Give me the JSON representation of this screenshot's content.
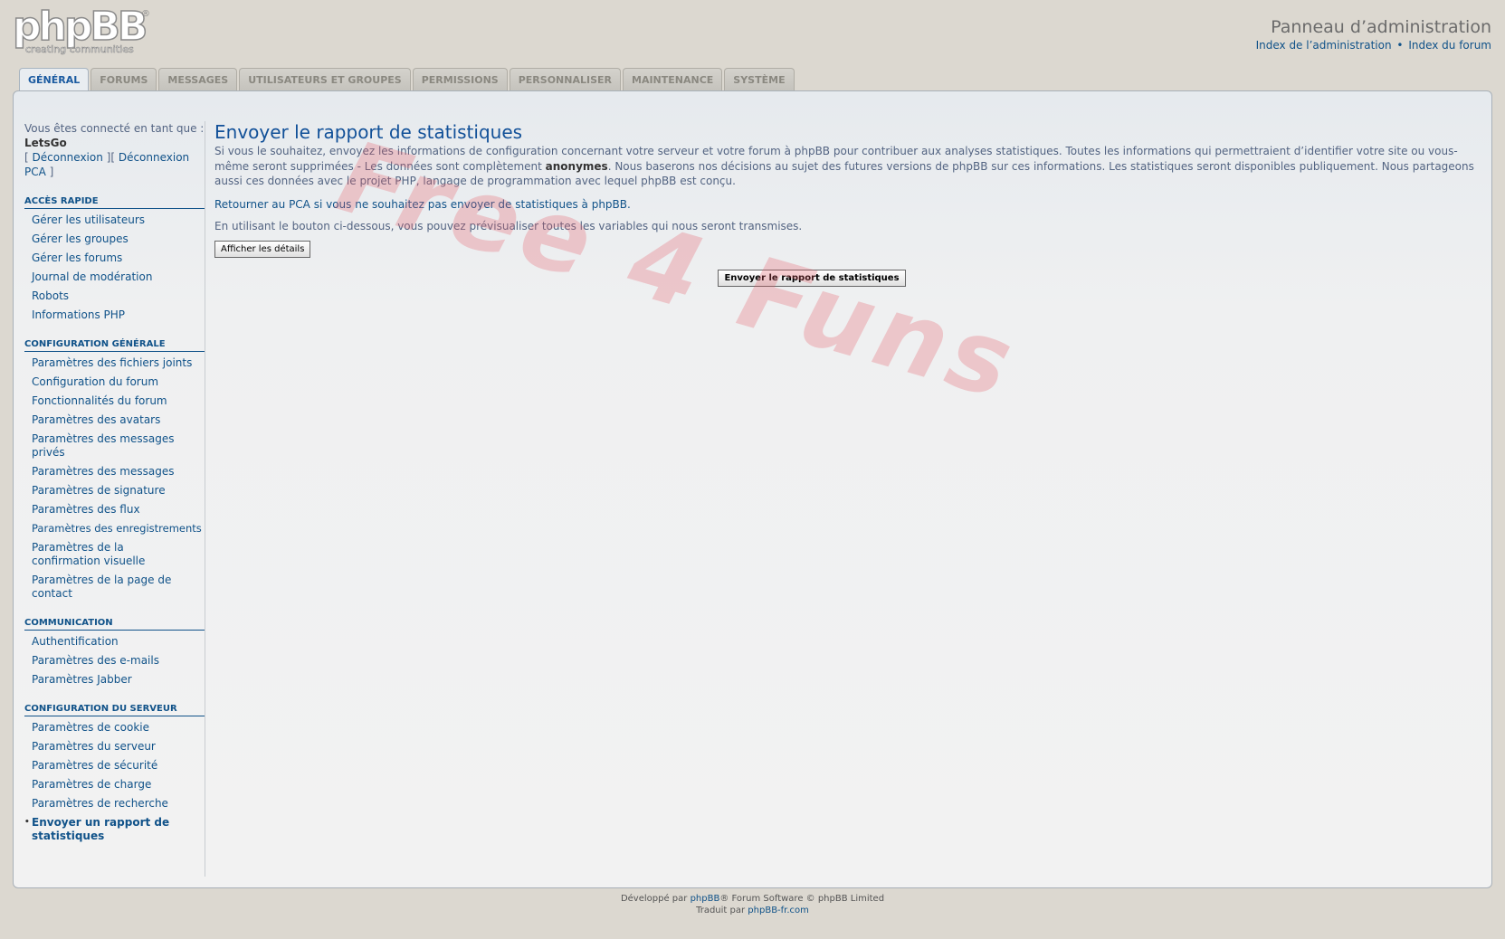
{
  "header": {
    "logo_text": "phpBB",
    "logo_reg": "®",
    "logo_tagline": "creating communities",
    "admin_title": "Panneau d’administration",
    "admin_index_link": "Index de l’administration",
    "separator": "•",
    "forum_index_link": "Index du forum"
  },
  "tabs": [
    {
      "label": "GÉNÉRAL",
      "active": true
    },
    {
      "label": "FORUMS"
    },
    {
      "label": "MESSAGES"
    },
    {
      "label": "UTILISATEURS ET GROUPES"
    },
    {
      "label": "PERMISSIONS"
    },
    {
      "label": "PERSONNALISER"
    },
    {
      "label": "MAINTENANCE"
    },
    {
      "label": "SYSTÈME"
    }
  ],
  "sidebar": {
    "logged_in_as": "Vous êtes connecté en tant que :",
    "username": "LetsGo",
    "logout_open": "[ ",
    "logout": "Déconnexion",
    "logout_mid": " ][ ",
    "logout_acp": "Déconnexion PCA",
    "logout_close": " ]",
    "sections": [
      {
        "title": "ACCÈS RAPIDE",
        "items": [
          "Gérer les utilisateurs",
          "Gérer les groupes",
          "Gérer les forums",
          "Journal de modération",
          "Robots",
          "Informations PHP"
        ]
      },
      {
        "title": "CONFIGURATION GÉNÉRALE",
        "items": [
          "Paramètres des fichiers joints",
          "Configuration du forum",
          "Fonctionnalités du forum",
          "Paramètres des avatars",
          "Paramètres des messages privés",
          "Paramètres des messages",
          "Paramètres de signature",
          "Paramètres des flux",
          "Paramètres des enregistrements",
          "Paramètres de la confirmation visuelle",
          "Paramètres de la page de contact"
        ]
      },
      {
        "title": "COMMUNICATION",
        "items": [
          "Authentification",
          "Paramètres des e-mails",
          "Paramètres Jabber"
        ]
      },
      {
        "title": "CONFIGURATION DU SERVEUR",
        "items": [
          "Paramètres de cookie",
          "Paramètres du serveur",
          "Paramètres de sécurité",
          "Paramètres de charge",
          "Paramètres de recherche",
          "Envoyer un rapport de statistiques"
        ],
        "active_index": 5
      }
    ]
  },
  "content": {
    "title": "Envoyer le rapport de statistiques",
    "intro_part1": "Si vous le souhaitez, envoyez les informations de configuration concernant votre serveur et votre forum à phpBB pour contribuer aux analyses statistiques. Toutes les informations qui permettraient d’identifier votre site ou vous-même seront supprimées - Les données sont complètement ",
    "intro_strong": "anonymes",
    "intro_part2": ". Nous baserons nos décisions au sujet des futures versions de phpBB sur ces informations. Les statistiques seront disponibles publiquement. Nous partageons aussi ces données avec le projet PHP, langage de programmation avec lequel phpBB est conçu.",
    "return_link": "Retourner au PCA si vous ne souhaitez pas envoyer de statistiques à phpBB.",
    "preview_text": "En utilisant le bouton ci-dessous, vous pouvez prévisualiser toutes les variables qui nous seront transmises.",
    "details_button": "Afficher les détails",
    "submit_button": "Envoyer le rapport de statistiques"
  },
  "watermark": "Free 4 Funs",
  "footer": {
    "developed_by": "Développé par ",
    "phpbb_link": "phpBB",
    "software": "® Forum Software © phpBB Limited",
    "translated_by": "Traduit par ",
    "translator_link": "phpBB-fr.com"
  }
}
